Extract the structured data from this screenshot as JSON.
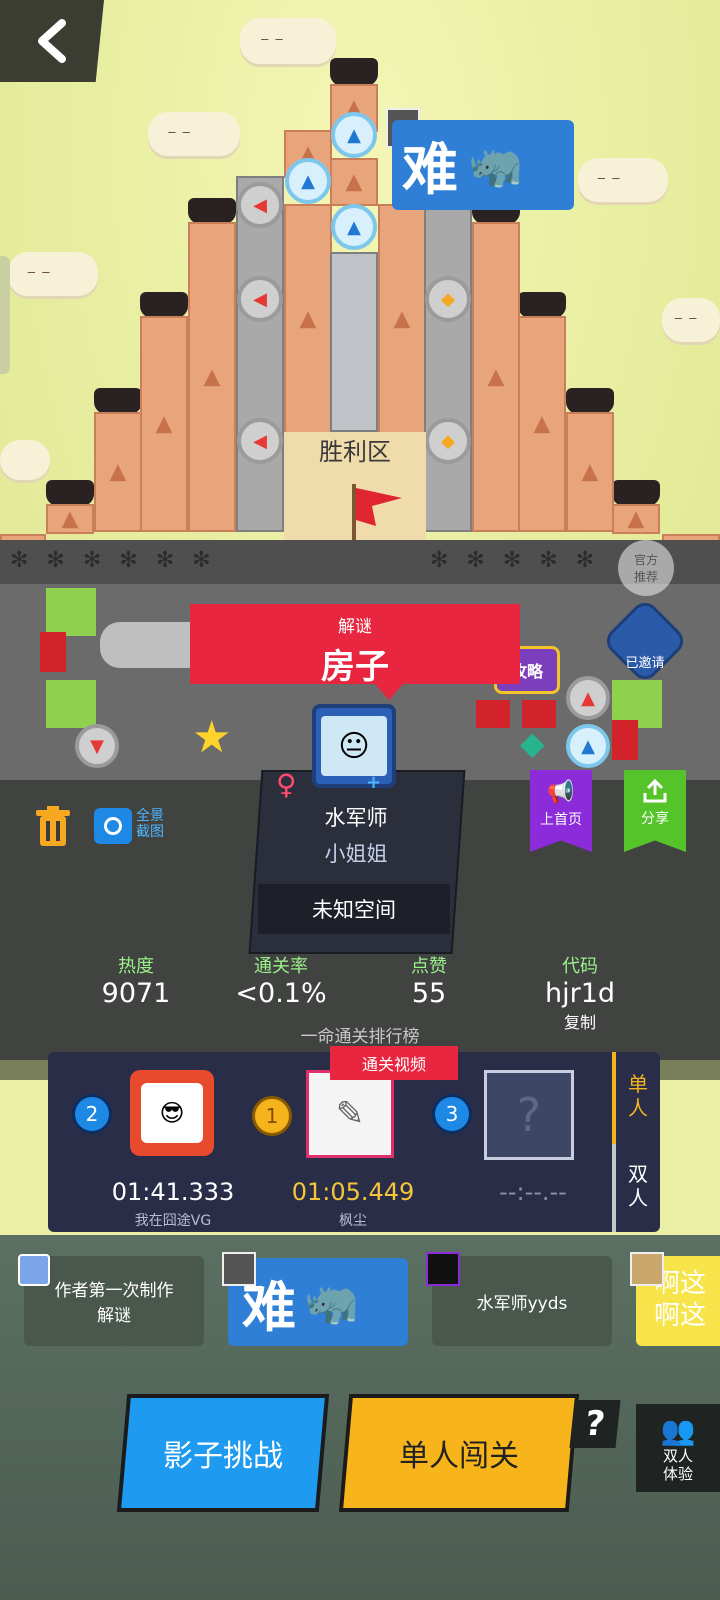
{
  "header": {
    "back_icon": "chevron-left-icon"
  },
  "badge_top": {
    "difficulty": "难"
  },
  "map": {
    "victory_zone_label": "胜利区",
    "official_recommend": "官方\n推荐",
    "invited": "已邀请",
    "guide": "攻略"
  },
  "level": {
    "category": "解谜",
    "title": "房子"
  },
  "author": {
    "gender_icon": "female-icon",
    "name": "水军师",
    "subtitle": "小姐姐",
    "space": "未知空间"
  },
  "toolbar": {
    "delete_icon": "trash-icon",
    "screenshot_label": "全景\n截图",
    "home_label": "上首页",
    "share_label": "分享"
  },
  "stats": [
    {
      "label": "热度",
      "value": "9071"
    },
    {
      "label": "通关率",
      "value": "<0.1%"
    },
    {
      "label": "点赞",
      "value": "55"
    },
    {
      "label": "代码",
      "value": "hjr1d",
      "extra": "复制"
    }
  ],
  "leaderboard": {
    "title": "一命通关排行榜",
    "video_tag": "通关视频",
    "entries": [
      {
        "rank": "2",
        "time": "01:41.333",
        "name": "我在囧途VG"
      },
      {
        "rank": "1",
        "time": "01:05.449",
        "name": "枫尘"
      },
      {
        "rank": "3",
        "time": "--:--.--",
        "name": ""
      }
    ],
    "tabs": [
      "单\n人",
      "双\n人"
    ]
  },
  "comments": [
    {
      "text": "作者第一次制作\n解谜"
    },
    {
      "text": "难"
    },
    {
      "text": "水军师yyds"
    },
    {
      "text": "啊这\n啊这"
    }
  ],
  "actions": {
    "shadow_challenge": "影子挑战",
    "solo_play": "单人闯关",
    "help": "?",
    "duo_try": "双人\n体验"
  },
  "colors": {
    "red_banner": "#e8263f",
    "blue_button": "#1e9af0",
    "yellow_button": "#f7b51b",
    "stat_label": "#9bf08b",
    "gold_time": "#f5c53a",
    "purple": "#8b2bd9",
    "green": "#54c42a"
  }
}
